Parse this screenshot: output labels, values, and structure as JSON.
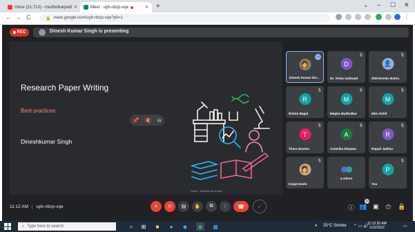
{
  "browser": {
    "tabs": [
      {
        "label": "Inbox (21,713) - mudholkarpatil",
        "favicon_color": "#ea4335"
      },
      {
        "label": "Meet - uyb-nbzp-vqe",
        "favicon_color": "#00897b"
      }
    ],
    "new_tab": "+",
    "url": "meet.google.com/uyb-nbzp-vqe?pli=1",
    "nav": {
      "back": "←",
      "forward": "→",
      "reload": "C"
    }
  },
  "meet": {
    "rec_label": "REC",
    "presenting_text": "Dinesh Kumar Singh is presenting",
    "slide": {
      "title": "Research Paper Writing",
      "subtitle": "Best practices",
      "author": "Dineshkumar Singh",
      "small_caption": "Paths - Instead via outline"
    },
    "participants": [
      {
        "name": "Dinesh Kumar Sin...",
        "initial": "",
        "color": "#8e7b6a",
        "active": true
      },
      {
        "name": "Dr. Vinita Gaikwad",
        "initial": "D",
        "color": "#7e57c2",
        "active": false
      },
      {
        "name": "Shirshendu Maitra",
        "initial": "",
        "color": "#9fa8da",
        "active": false
      },
      {
        "name": "Rohini Bagul",
        "initial": "R",
        "color": "#12a4a4",
        "active": false
      },
      {
        "name": "Megha Mudholkar",
        "initial": "M",
        "color": "#12a4a4",
        "active": false
      },
      {
        "name": "Mira Oshil",
        "initial": "M",
        "color": "#12a4a4",
        "active": false
      },
      {
        "name": "Thara Naveen",
        "initial": "T",
        "color": "#e91e63",
        "active": false
      },
      {
        "name": "Anamika Dhawan",
        "initial": "A",
        "color": "#1b7a3e",
        "active": false
      },
      {
        "name": "Rupali Jadhav",
        "initial": "R",
        "color": "#7e57c2",
        "active": false
      },
      {
        "name": "Kinjal Doshi",
        "initial": "",
        "color": "#c7a98b",
        "active": false
      },
      {
        "name": "4 others",
        "initial": "",
        "color": "#5c6bc0",
        "active": false
      },
      {
        "name": "You",
        "initial": "P",
        "color": "#12a4a4",
        "active": false
      }
    ],
    "bottom": {
      "time": "11:12 AM",
      "separator": "|",
      "meeting_code": "uyb-nbzp-vqe",
      "people_count": "16"
    }
  },
  "taskbar": {
    "search_placeholder": "Type here to search",
    "weather": "25°C  Smoke",
    "time": "11:12:30 AM",
    "date": "1/15/2022"
  },
  "colors": {
    "meet_bg": "#202124",
    "tile_bg": "#3c4043",
    "accent_blue": "#8ab4f8",
    "red": "#ea4335"
  }
}
